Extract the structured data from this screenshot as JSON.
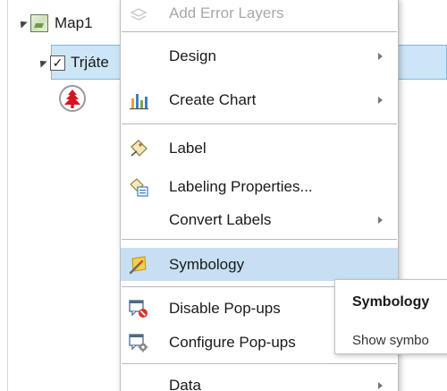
{
  "contents": {
    "map_label": "Map1",
    "layer_label": "Trjáte",
    "layer_checkbox_checked": true,
    "layer_checkbox_glyph": "✓",
    "icons": {
      "map": "map-icon",
      "symbol": "tree-symbol-icon"
    }
  },
  "menu": {
    "items": [
      {
        "label": "Add Error Layers",
        "icon": "error-layers-icon",
        "disabled": true,
        "submenu": false
      },
      {
        "label": "Design",
        "icon": "",
        "submenu": true
      },
      {
        "label": "Create Chart",
        "icon": "chart-icon",
        "submenu": true
      },
      {
        "label": "Label",
        "icon": "label-icon",
        "submenu": false
      },
      {
        "label": "Labeling Properties...",
        "icon": "labeling-properties-icon",
        "submenu": false
      },
      {
        "label": "Convert Labels",
        "icon": "",
        "submenu": true
      },
      {
        "label": "Symbology",
        "icon": "symbology-icon",
        "submenu": false,
        "highlighted": true
      },
      {
        "label": "Disable Pop-ups",
        "icon": "disable-popups-icon",
        "submenu": false
      },
      {
        "label": "Configure Pop-ups",
        "icon": "configure-popups-icon",
        "submenu": false
      },
      {
        "label": "Data",
        "icon": "",
        "submenu": true
      }
    ],
    "colors": {
      "highlight": "#c7dff2",
      "chart_bars": [
        "#e8a13a",
        "#3b7fc4",
        "#7aa64b"
      ]
    }
  },
  "tooltip": {
    "title": "Symbology",
    "description": "Show symbo"
  }
}
